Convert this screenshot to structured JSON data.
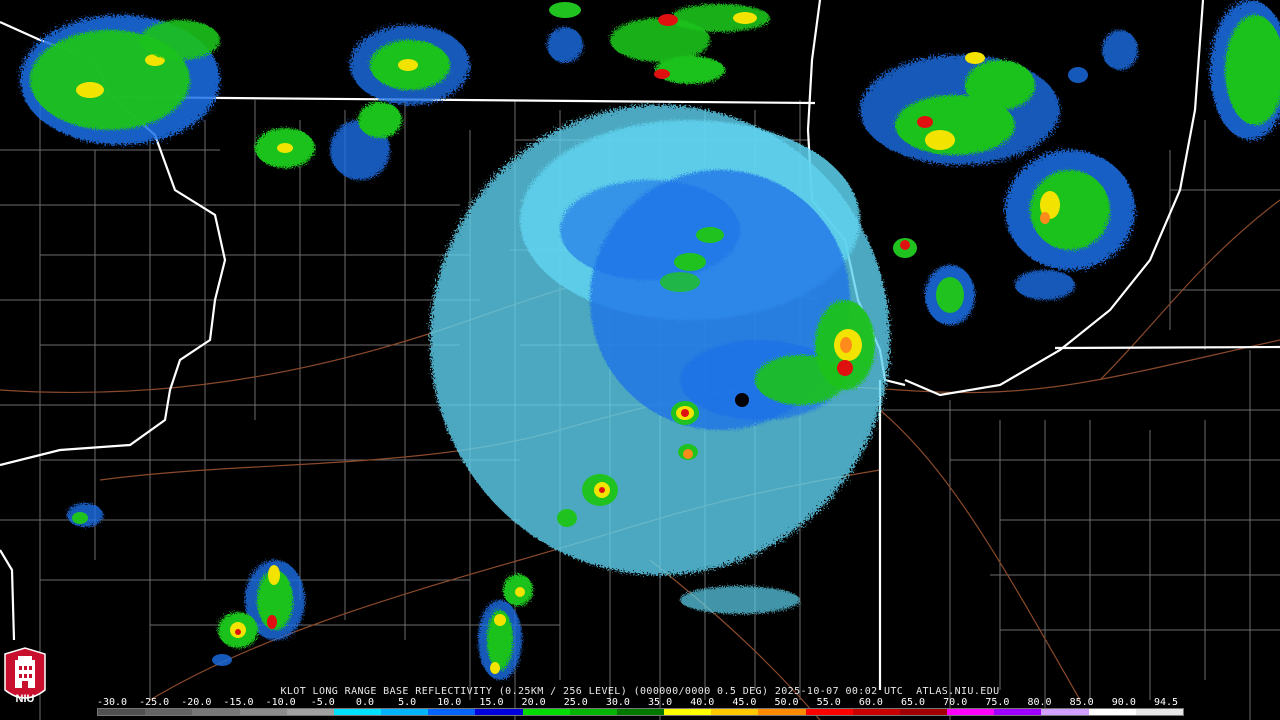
{
  "title": "KLOT LONG RANGE BASE REFLECTIVITY (0.25KM / 256 LEVEL) (000000/0000 0.5 DEG) 2025-10-07 00:02 UTC  ATLAS.NIU.EDU",
  "logo": {
    "text": "NIU",
    "icon": "niu-tower-logo-icon"
  },
  "legend": {
    "tick_labels": [
      "-30.0",
      "-25.0",
      "-20.0",
      "-15.0",
      "-10.0",
      "-5.0",
      "0.0",
      "5.0",
      "10.0",
      "15.0",
      "20.0",
      "25.0",
      "30.0",
      "35.0",
      "40.0",
      "45.0",
      "50.0",
      "55.0",
      "60.0",
      "65.0",
      "70.0",
      "75.0",
      "80.0",
      "85.0",
      "90.0",
      "94.5"
    ],
    "colors": [
      "#505050",
      "#646464",
      "#787878",
      "#8c8c8c",
      "#a0a0a0",
      "#00e0ff",
      "#00b4ff",
      "#0064ff",
      "#0000dc",
      "#00dc00",
      "#00b400",
      "#007800",
      "#ffff00",
      "#ffc800",
      "#ff8c00",
      "#ff0000",
      "#c80000",
      "#a00000",
      "#ff00ff",
      "#a000ff",
      "#d2a0ff",
      "#ffffff",
      "#e6e6e6"
    ]
  },
  "colors": {
    "background": "#000000",
    "county_lines": "#8a8a8a",
    "state_lines": "#ffffff",
    "highways": "#8b4a2b",
    "light_blue": "#5fd3f0",
    "blue": "#1a6fe8",
    "green": "#1fc21f",
    "yellow": "#f2e400",
    "orange": "#ff8c1a",
    "red": "#e01010"
  }
}
